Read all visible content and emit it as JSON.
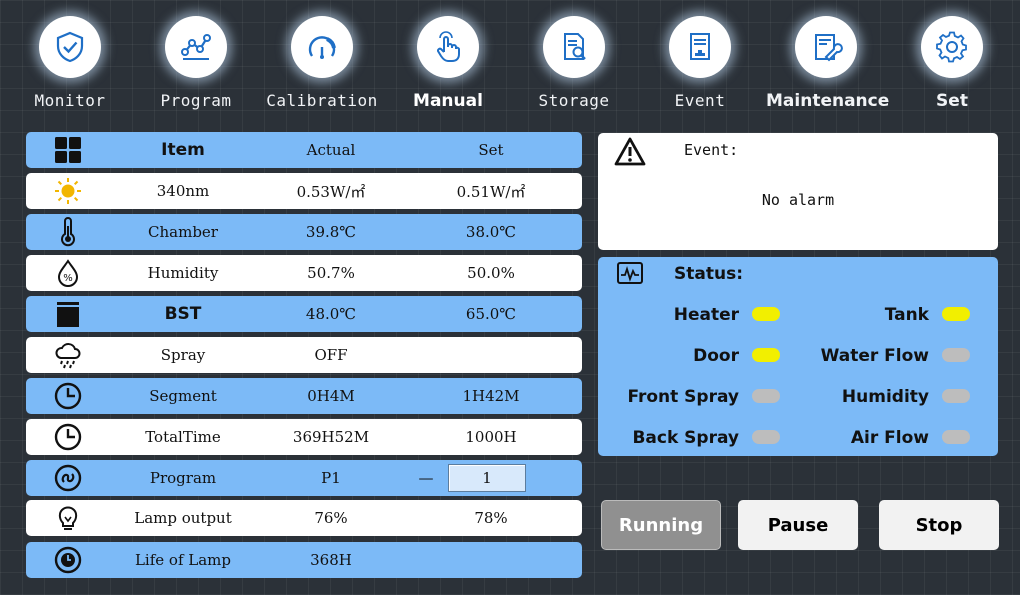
{
  "nav": [
    {
      "label": "Monitor",
      "icon": "shield-check-icon",
      "style": "mono"
    },
    {
      "label": "Program",
      "icon": "chart-line-icon",
      "style": "mono"
    },
    {
      "label": "Calibration",
      "icon": "gauge-icon",
      "style": "mono"
    },
    {
      "label": "Manual",
      "icon": "hand-pointer-icon",
      "style": "bold",
      "active": true
    },
    {
      "label": "Storage",
      "icon": "document-search-icon",
      "style": "mono"
    },
    {
      "label": "Event",
      "icon": "document-stamp-icon",
      "style": "mono"
    },
    {
      "label": "Maintenance",
      "icon": "wrench-document-icon",
      "style": "bold"
    },
    {
      "label": "Set",
      "icon": "gear-icon",
      "style": "bold"
    }
  ],
  "table": {
    "header": {
      "item": "Item",
      "actual": "Actual",
      "set": "Set"
    },
    "rows": [
      {
        "name": "340nm",
        "actual": "0.53W/㎡",
        "set": "0.51W/㎡",
        "icon": "sun-icon"
      },
      {
        "name": "Chamber",
        "actual": "39.8℃",
        "set": "38.0℃",
        "icon": "thermometer-icon"
      },
      {
        "name": "Humidity",
        "actual": "50.7%",
        "set": "50.0%",
        "icon": "humidity-drop-icon"
      },
      {
        "name": "BST",
        "actual": "48.0℃",
        "set": "65.0℃",
        "icon": "black-panel-icon"
      },
      {
        "name": "Spray",
        "actual": "OFF",
        "set": "",
        "icon": "rain-cloud-icon"
      },
      {
        "name": "Segment",
        "actual": "0H4M",
        "set": "1H42M",
        "icon": "clock-icon"
      },
      {
        "name": "TotalTime",
        "actual": "369H52M",
        "set": "1000H",
        "icon": "clock-icon"
      },
      {
        "name": "Program",
        "actual": "P1",
        "set_dash": "—",
        "set_value": "1",
        "icon": "program-loop-icon"
      },
      {
        "name": "Lamp output",
        "actual": "76%",
        "set": "78%",
        "icon": "bulb-icon"
      },
      {
        "name": "Life of Lamp",
        "actual": "368H",
        "set": "",
        "icon": "lamp-clock-icon"
      }
    ]
  },
  "event": {
    "title": "Event:",
    "message": "No alarm"
  },
  "status": {
    "title": "Status:",
    "items": [
      {
        "label": "Heater",
        "on": true
      },
      {
        "label": "Tank",
        "on": true
      },
      {
        "label": "Door",
        "on": true
      },
      {
        "label": "Water Flow",
        "on": false
      },
      {
        "label": "Front Spray",
        "on": false
      },
      {
        "label": "Humidity",
        "on": false
      },
      {
        "label": "Back Spray",
        "on": false
      },
      {
        "label": "Air Flow",
        "on": false
      }
    ]
  },
  "buttons": {
    "running": "Running",
    "pause": "Pause",
    "stop": "Stop"
  },
  "colors": {
    "panel_blue": "#7cbaf7",
    "lamp_on": "#f2ef00",
    "lamp_off": "#bdbdbd",
    "icon_blue": "#1f6fc6"
  }
}
